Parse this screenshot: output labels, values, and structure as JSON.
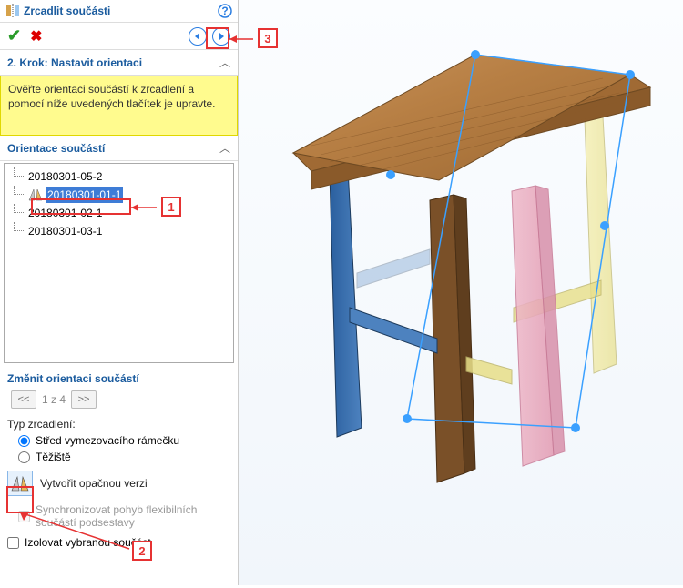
{
  "header": {
    "title": "Zrcadlit součásti"
  },
  "step": {
    "label": "2. Krok: Nastavit orientaci",
    "hint": "Ověřte orientaci součástí k zrcadlení a pomocí níže uvedených tlačítek je upravte."
  },
  "orientation": {
    "header": "Orientace součástí",
    "items": [
      {
        "label": "20180301-05-2",
        "selected": false
      },
      {
        "label": "20180301-01-1",
        "selected": true
      },
      {
        "label": "20180301-02-1",
        "selected": false
      },
      {
        "label": "20180301-03-1",
        "selected": false
      }
    ]
  },
  "change_orientation": {
    "header": "Změnit orientaci součástí",
    "pager": "1 z 4",
    "prev": "<<",
    "next": ">>"
  },
  "mirror_type": {
    "label": "Typ zrcadlení:",
    "opt_bbox": "Střed vymezovacího rámečku",
    "opt_centroid": "Těžiště"
  },
  "opposite": {
    "label": "Vytvořit opačnou verzi"
  },
  "sync": {
    "label": "Synchronizovat pohyb flexibilních součástí podsestavy"
  },
  "isolate": {
    "label": "Izolovat vybranou součást"
  },
  "callouts": {
    "c1": "1",
    "c2": "2",
    "c3": "3"
  }
}
